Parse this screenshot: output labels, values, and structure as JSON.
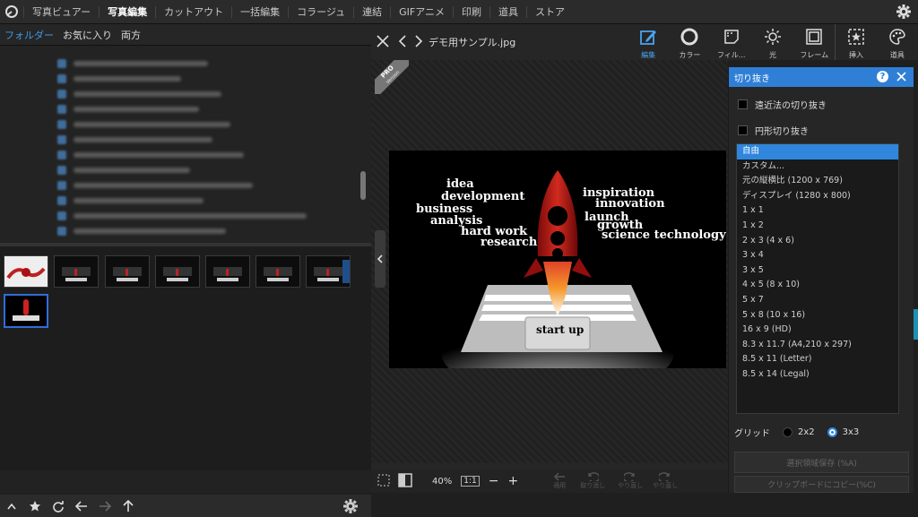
{
  "top_nav": {
    "items": [
      "写真ビュアー",
      "写真編集",
      "カットアウト",
      "一括編集",
      "コラージュ",
      "連結",
      "GIFアニメ",
      "印刷",
      "道具",
      "ストア"
    ],
    "active_index": 1
  },
  "left_tabs": {
    "items": [
      "フォルダー",
      "お気に入り",
      "両方"
    ],
    "active_index": 0
  },
  "editor": {
    "filename": "デモ用サンプル.jpg",
    "zoom": "40%",
    "one_to_one": "1:1",
    "pro_badge": "PRO",
    "pro_sub": "Version"
  },
  "tools": [
    {
      "label": "編集",
      "icon": "pencil-icon",
      "active": true
    },
    {
      "label": "カラー",
      "icon": "circle-icon",
      "active": false
    },
    {
      "label": "フィル...",
      "icon": "filter-icon",
      "active": false
    },
    {
      "label": "光",
      "icon": "sun-icon",
      "active": false
    },
    {
      "label": "フレーム",
      "icon": "frame-icon",
      "active": false
    },
    {
      "label": "挿入",
      "icon": "insert-icon",
      "active": false
    },
    {
      "label": "道具",
      "icon": "palette-icon",
      "active": false
    }
  ],
  "crop_panel": {
    "title": "切り抜き",
    "perspective_label": "遠近法の切り抜き",
    "circle_label": "円形切り抜き",
    "ratios": [
      "自由",
      "カスタム...",
      "元の縦横比 (1200 x 769)",
      "ディスプレイ (1280 x 800)",
      "1 x 1",
      "1 x 2",
      "2 x 3 (4 x 6)",
      "3 x 4",
      "3 x 5",
      "4 x 5 (8 x 10)",
      "5 x 7",
      "5 x 8 (10 x 16)",
      "16 x 9 (HD)",
      "8.3 x 11.7 (A4,210 x 297)",
      "8.5 x 11 (Letter)",
      "8.5 x 14 (Legal)"
    ],
    "selected_index": 0,
    "grid_label": "グリッド",
    "grid_options": [
      "2x2",
      "3x3"
    ],
    "grid_selected": "3x3",
    "save_button": "選択領域保存 (%A)",
    "copy_button": "クリップボードにコピー(%C)"
  },
  "photo_words": {
    "idea": "idea",
    "development": "development",
    "business": "business",
    "analysis": "analysis",
    "hard_work": "hard work",
    "research": "research",
    "inspiration": "inspiration",
    "innovation": "innovation",
    "launch": "launch",
    "growth": "growth",
    "science_technology": "science technology",
    "start_up": "start up"
  },
  "edit_actions": [
    "適用",
    "取り消し",
    "やり直し",
    "やり直し"
  ],
  "colors": {
    "accent": "#2f86dc",
    "active_tab": "#3d9be9",
    "header_bg": "#2b2b2b"
  }
}
